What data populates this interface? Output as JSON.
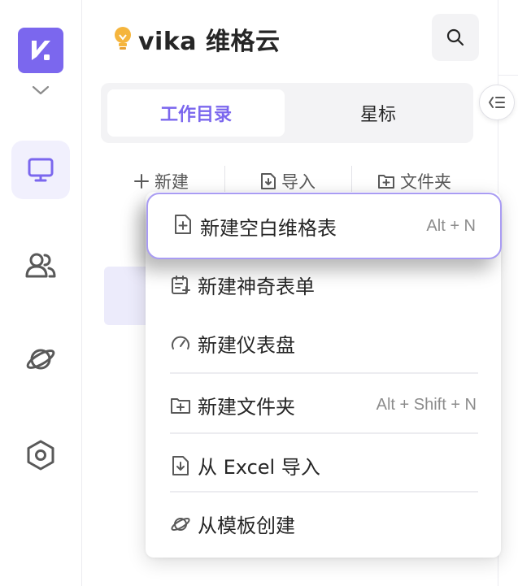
{
  "app": {
    "brand_name": "vika 维格云",
    "brand_icon": "lightbulb-icon",
    "logo_icon": "vika-logo-icon"
  },
  "rail": {
    "items": [
      {
        "name": "workbench",
        "icon": "monitor-icon",
        "active": true
      },
      {
        "name": "members",
        "icon": "users-icon",
        "active": false
      },
      {
        "name": "explore",
        "icon": "planet-icon",
        "active": false
      },
      {
        "name": "settings",
        "icon": "hexagon-settings-icon",
        "active": false
      }
    ]
  },
  "tabs": [
    {
      "label": "工作目录",
      "active": true
    },
    {
      "label": "星标",
      "active": false
    }
  ],
  "actions": [
    {
      "label": "新建",
      "icon": "plus-icon"
    },
    {
      "label": "导入",
      "icon": "import-icon"
    },
    {
      "label": "文件夹",
      "icon": "folder-plus-icon"
    }
  ],
  "menu": {
    "items": [
      {
        "label": "新建空白维格表",
        "shortcut": "Alt + N",
        "icon": "new-sheet-icon"
      },
      {
        "label": "新建神奇表单",
        "shortcut": "",
        "icon": "form-icon"
      },
      {
        "label": "新建仪表盘",
        "shortcut": "",
        "icon": "dashboard-icon"
      },
      {
        "label": "新建文件夹",
        "shortcut": "Alt + Shift + N",
        "icon": "folder-plus-icon"
      },
      {
        "label": "从 Excel 导入",
        "shortcut": "",
        "icon": "import-icon"
      },
      {
        "label": "从模板创建",
        "shortcut": "",
        "icon": "planet-icon"
      }
    ]
  },
  "colors": {
    "accent": "#7b67ee",
    "accent_light": "#f1f0fd",
    "highlight_border": "#a99cf3",
    "icon_gray": "#595959"
  }
}
